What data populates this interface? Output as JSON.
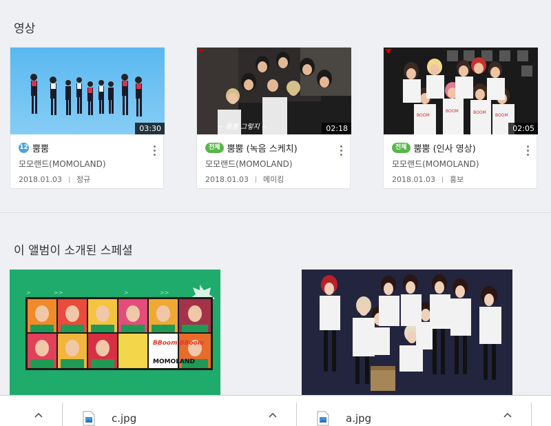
{
  "sections": {
    "videos_title": "영상",
    "special_title": "이 앨범이 소개된 스페셜"
  },
  "videos": [
    {
      "rating": "12",
      "title": "뿜뿜",
      "artist": "모모랜드(MOMOLAND)",
      "date": "2018.01.03",
      "category": "정규",
      "duration": "03:30"
    },
    {
      "rating": "전체",
      "title": "뿜뿜 (녹음 스케치)",
      "artist": "모모랜드(MOMOLAND)",
      "date": "2018.01.03",
      "category": "메이킹",
      "duration": "02:18"
    },
    {
      "rating": "전체",
      "title": "뿜뿜 (인사 영상)",
      "artist": "모모랜드(MOMOLAND)",
      "date": "2018.01.03",
      "category": "홍보",
      "duration": "02:05"
    }
  ],
  "specials": {
    "album_logo": "MOMOLAND",
    "album_title": "BBoom BBoom"
  },
  "downloads": [
    {
      "name": "c.jpg"
    },
    {
      "name": "a.jpg"
    }
  ],
  "colors": {
    "background": "#eef0f4",
    "badge_12": "#4aa3e0",
    "badge_all": "#58b64a",
    "special_green": "#1fab6b",
    "special_navy": "#23253f"
  }
}
